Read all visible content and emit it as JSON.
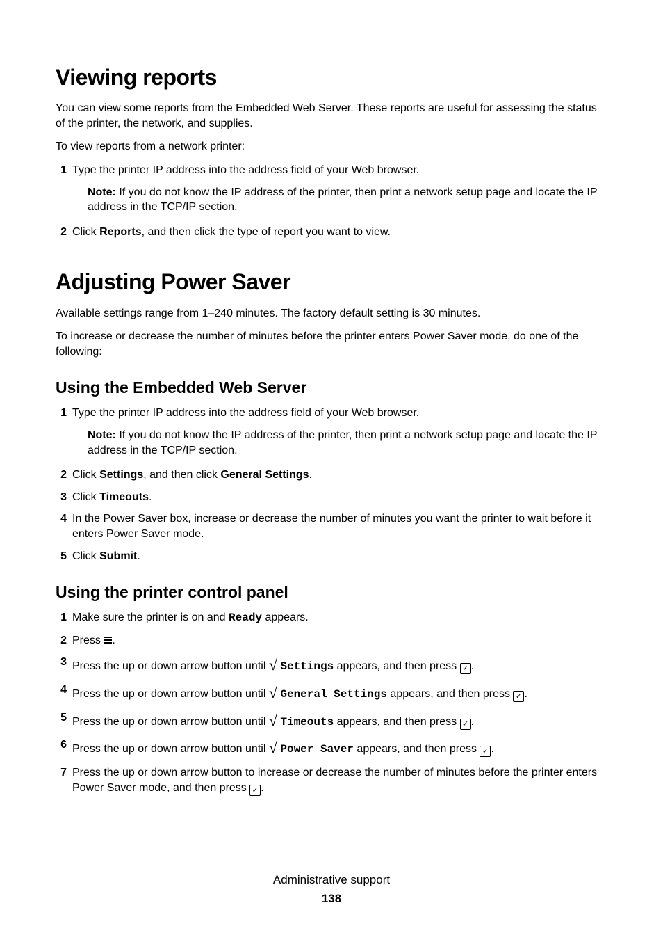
{
  "section1": {
    "heading": "Viewing reports",
    "intro": "You can view some reports from the Embedded Web Server. These reports are useful for assessing the status of the printer, the network, and supplies.",
    "lead": "To view reports from a network printer:",
    "step1": "Type the printer IP address into the address field of your Web browser.",
    "note_label": "Note:",
    "note1": " If you do not know the IP address of the printer, then print a network setup page and locate the IP address in the TCP/IP section.",
    "step2_a": "Click ",
    "step2_b": "Reports",
    "step2_c": ", and then click the type of report you want to view."
  },
  "section2": {
    "heading": "Adjusting Power Saver",
    "p1": "Available settings range from 1–240 minutes. The factory default setting is 30 minutes.",
    "p2": "To increase or decrease the number of minutes before the printer enters Power Saver mode, do one of the following:"
  },
  "section3": {
    "heading": "Using the Embedded Web Server",
    "step1": "Type the printer IP address into the address field of your Web browser.",
    "note_label": "Note:",
    "note1": " If you do not know the IP address of the printer, then print a network setup page and locate the IP address in the TCP/IP section.",
    "s2a": "Click ",
    "s2b": "Settings",
    "s2c": ", and then click ",
    "s2d": "General Settings",
    "s2e": ".",
    "s3a": "Click ",
    "s3b": "Timeouts",
    "s3c": ".",
    "s4": "In the Power Saver box, increase or decrease the number of minutes you want the printer to wait before it enters Power Saver mode.",
    "s5a": "Click ",
    "s5b": "Submit",
    "s5c": "."
  },
  "section4": {
    "heading": "Using the printer control panel",
    "s1a": "Make sure the printer is on and ",
    "s1b": "Ready",
    "s1c": " appears.",
    "s2a": "Press ",
    "s2b": ".",
    "arrow_lead": "Press the up or down arrow button until ",
    "appears_then": " appears, and then press ",
    "period": ".",
    "opt3": "Settings",
    "opt4": "General Settings",
    "opt5": "Timeouts",
    "opt6": "Power Saver",
    "s7a": "Press the up or down arrow button to increase or decrease the number of minutes before the printer enters Power Saver mode, and then press ",
    "sqrt": "√",
    "check": "✓"
  },
  "footer": {
    "title": "Administrative support",
    "page": "138"
  }
}
